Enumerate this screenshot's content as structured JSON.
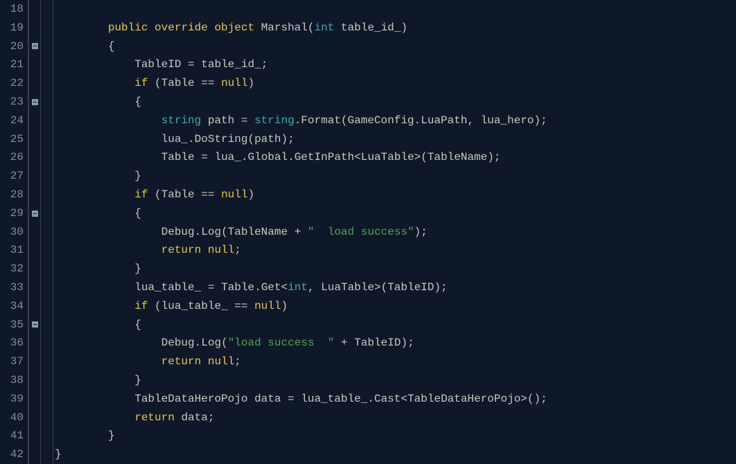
{
  "lineNumbers": [
    "18",
    "19",
    "20",
    "21",
    "22",
    "23",
    "24",
    "25",
    "26",
    "27",
    "28",
    "29",
    "30",
    "31",
    "32",
    "33",
    "34",
    "35",
    "36",
    "37",
    "38",
    "39",
    "40",
    "41",
    "42"
  ],
  "foldMarkers": [
    false,
    false,
    true,
    false,
    false,
    true,
    false,
    false,
    false,
    false,
    false,
    true,
    false,
    false,
    false,
    false,
    false,
    true,
    false,
    false,
    false,
    false,
    false,
    false,
    false
  ],
  "code": {
    "l18": {
      "indent": ""
    },
    "l19": {
      "indent": "        ",
      "k1": "public",
      "sp1": " ",
      "k2": "override",
      "sp2": " ",
      "k3": "object",
      "sp3": " ",
      "id1": "Marshal",
      "p1": "(",
      "t1": "int",
      "sp4": " ",
      "id2": "table_id_",
      "p2": ")"
    },
    "l20": {
      "indent": "        ",
      "p1": "{"
    },
    "l21": {
      "indent": "            ",
      "id1": "TableID",
      "sp1": " ",
      "op1": "=",
      "sp2": " ",
      "id2": "table_id_",
      "p1": ";"
    },
    "l22": {
      "indent": "            ",
      "k1": "if",
      "sp1": " ",
      "p1": "(",
      "id1": "Table",
      "sp2": " ",
      "op1": "==",
      "sp3": " ",
      "k2": "null",
      "p2": ")"
    },
    "l23": {
      "indent": "            ",
      "p1": "{"
    },
    "l24": {
      "indent": "                ",
      "t1": "string",
      "sp1": " ",
      "id1": "path",
      "sp2": " ",
      "op1": "=",
      "sp3": " ",
      "t2": "string",
      "p1": ".",
      "id2": "Format",
      "p2": "(",
      "id3": "GameConfig",
      "p3": ".",
      "id4": "LuaPath",
      "p4": ",",
      "sp4": " ",
      "id5": "lua_hero",
      "p5": ")",
      ";": ";"
    },
    "l25": {
      "indent": "                ",
      "id1": "lua_",
      "p1": ".",
      "id2": "DoString",
      "p2": "(",
      "id3": "path",
      "p3": ")",
      ";": ";"
    },
    "l26": {
      "indent": "                ",
      "id1": "Table",
      "sp1": " ",
      "op1": "=",
      "sp2": " ",
      "id2": "lua_",
      "p1": ".",
      "id3": "Global",
      "p2": ".",
      "id4": "GetInPath",
      "p3": "<",
      "id5": "LuaTable",
      "p4": ">",
      "p5": "(",
      "id6": "TableName",
      "p6": ")",
      ";": ";"
    },
    "l27": {
      "indent": "            ",
      "p1": "}"
    },
    "l28": {
      "indent": "            ",
      "k1": "if",
      "sp1": " ",
      "p1": "(",
      "id1": "Table",
      "sp2": " ",
      "op1": "==",
      "sp3": " ",
      "k2": "null",
      "p2": ")"
    },
    "l29": {
      "indent": "            ",
      "p1": "{"
    },
    "l30": {
      "indent": "                ",
      "id1": "Debug",
      "p1": ".",
      "id2": "Log",
      "p2": "(",
      "id3": "TableName",
      "sp1": " ",
      "op1": "+",
      "sp2": " ",
      "s1": "\"  load success\"",
      "p3": ")",
      ";": ";"
    },
    "l31": {
      "indent": "                ",
      "k1": "return",
      "sp1": " ",
      "k2": "null",
      "p1": ";"
    },
    "l32": {
      "indent": "            ",
      "p1": "}"
    },
    "l33": {
      "indent": "            ",
      "id1": "lua_table_",
      "sp1": " ",
      "op1": "=",
      "sp2": " ",
      "id2": "Table",
      "p1": ".",
      "id3": "Get",
      "p2": "<",
      "t1": "int",
      "p3": ",",
      "sp3": " ",
      "id4": "LuaTable",
      "p4": ">",
      "p5": "(",
      "id5": "TableID",
      "p6": ")",
      ";": ";"
    },
    "l34": {
      "indent": "            ",
      "k1": "if",
      "sp1": " ",
      "p1": "(",
      "id1": "lua_table_",
      "sp2": " ",
      "op1": "==",
      "sp3": " ",
      "k2": "null",
      "p2": ")"
    },
    "l35": {
      "indent": "            ",
      "p1": "{"
    },
    "l36": {
      "indent": "                ",
      "id1": "Debug",
      "p1": ".",
      "id2": "Log",
      "p2": "(",
      "s1": "\"load success  \"",
      "sp1": " ",
      "op1": "+",
      "sp2": " ",
      "id3": "TableID",
      "p3": ")",
      ";": ";"
    },
    "l37": {
      "indent": "                ",
      "k1": "return",
      "sp1": " ",
      "k2": "null",
      "p1": ";"
    },
    "l38": {
      "indent": "            ",
      "p1": "}"
    },
    "l39": {
      "indent": "            ",
      "id1": "TableDataHeroPojo",
      "sp1": " ",
      "id2": "data",
      "sp2": " ",
      "op1": "=",
      "sp3": " ",
      "id3": "lua_table_",
      "p1": ".",
      "id4": "Cast",
      "p2": "<",
      "id5": "TableDataHeroPojo",
      "p3": ">",
      "p4": "(",
      ")": ")",
      ";": ";"
    },
    "l40": {
      "indent": "            ",
      "k1": "return",
      "sp1": " ",
      "id1": "data",
      "p1": ";"
    },
    "l41": {
      "indent": "        ",
      "p1": "}"
    },
    "l42": {
      "indent": "",
      "p1": "}"
    }
  }
}
